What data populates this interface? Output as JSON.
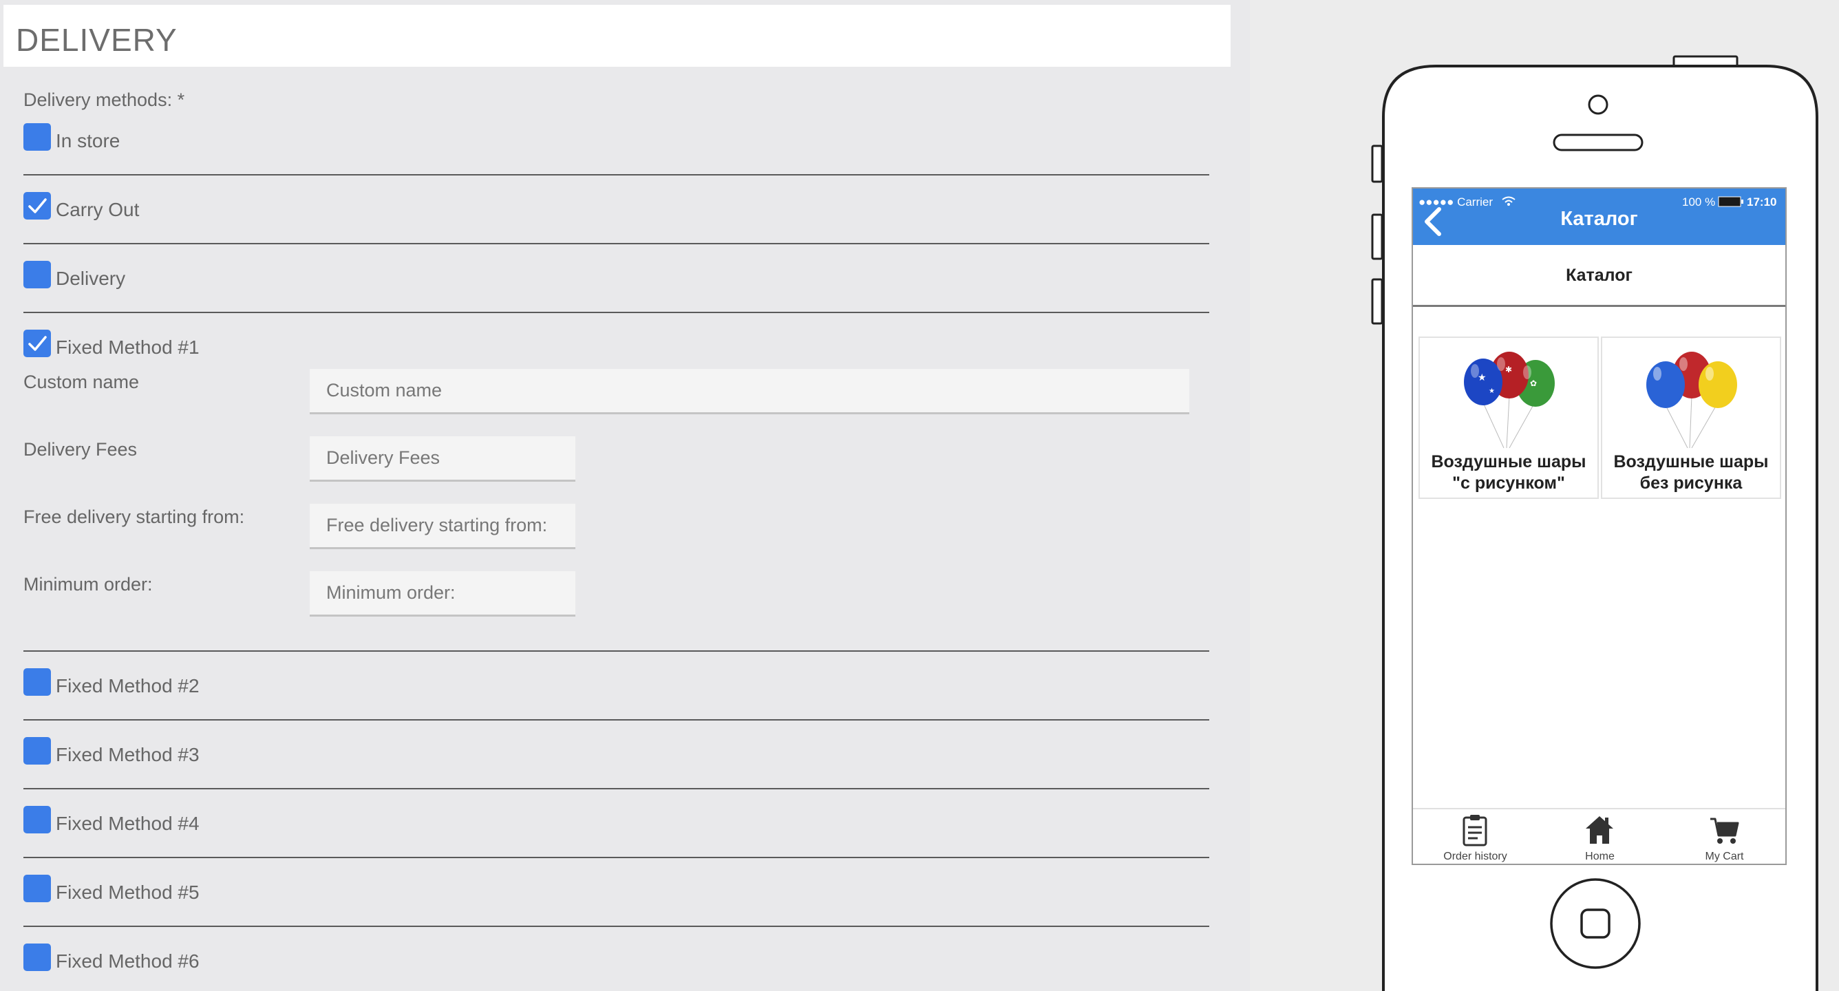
{
  "panel": {
    "title": "DELIVERY",
    "methods_label": "Delivery methods: *",
    "methods": [
      {
        "label": "In store",
        "checked": false
      },
      {
        "label": "Carry Out",
        "checked": true
      },
      {
        "label": "Delivery",
        "checked": false
      },
      {
        "label": "Fixed Method #1",
        "checked": true
      },
      {
        "label": "Fixed Method #2",
        "checked": false
      },
      {
        "label": "Fixed Method #3",
        "checked": false
      },
      {
        "label": "Fixed Method #4",
        "checked": false
      },
      {
        "label": "Fixed Method #5",
        "checked": false
      },
      {
        "label": "Fixed Method #6",
        "checked": false
      }
    ],
    "fields": {
      "custom_name": {
        "label": "Custom name",
        "placeholder": "Custom name",
        "value": ""
      },
      "delivery_fees": {
        "label": "Delivery Fees",
        "placeholder": "Delivery Fees",
        "value": ""
      },
      "free_delivery": {
        "label": "Free delivery starting from:",
        "placeholder": "Free delivery starting from:",
        "value": ""
      },
      "minimum_order": {
        "label": "Minimum order:",
        "placeholder": "Minimum order:",
        "value": ""
      }
    }
  },
  "phone": {
    "status": {
      "carrier": "●●●●● Carrier",
      "battery": "100 %",
      "time": "17:10"
    },
    "nav_title": "Каталог",
    "sub_title": "Каталог",
    "categories": [
      {
        "line1": "Воздушные шары",
        "line2": "\"с рисунком\""
      },
      {
        "line1": "Воздушные шары",
        "line2": "без рисунка"
      }
    ],
    "tabs": [
      {
        "label": "Order history",
        "icon": "clipboard-icon"
      },
      {
        "label": "Home",
        "icon": "home-icon"
      },
      {
        "label": "My Cart",
        "icon": "cart-icon"
      }
    ]
  },
  "colors": {
    "checkbox": "#3b7de8",
    "nav_bar": "#3b87e0",
    "panel_bg": "#e9e9eb"
  }
}
